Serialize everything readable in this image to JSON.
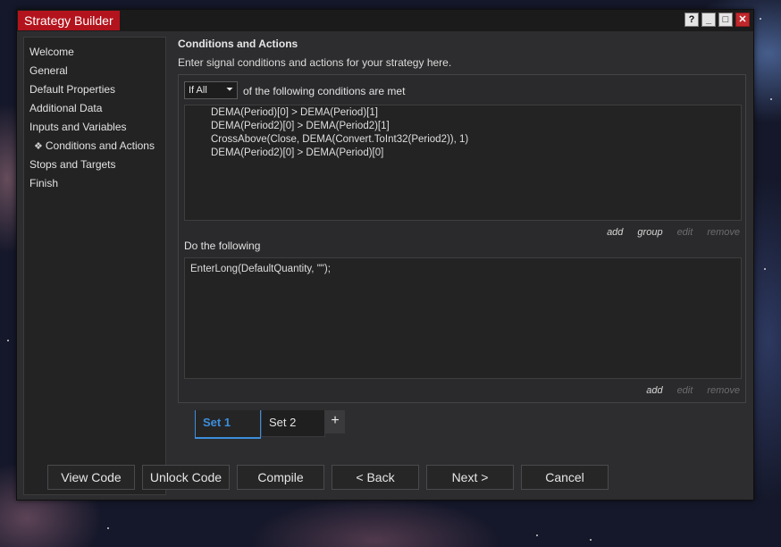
{
  "window": {
    "title": "Strategy Builder",
    "controls": {
      "help": "?",
      "minimize": "_",
      "maximize": "□",
      "close": "✕"
    }
  },
  "sidebar": {
    "items": [
      {
        "label": "Welcome"
      },
      {
        "label": "General"
      },
      {
        "label": "Default Properties"
      },
      {
        "label": "Additional Data"
      },
      {
        "label": "Inputs and Variables"
      },
      {
        "label": "Conditions and Actions",
        "bullet": "❖"
      },
      {
        "label": "Stops and Targets"
      },
      {
        "label": "Finish"
      }
    ]
  },
  "main": {
    "heading": "Conditions and Actions",
    "subheading": "Enter signal conditions and actions for your strategy here.",
    "conditions": {
      "mode_selected": "If All",
      "mode_arrow": "❯",
      "mode_suffix": "of the following conditions are met",
      "lines": [
        "DEMA(Period)[0] > DEMA(Period)[1]",
        "DEMA(Period2)[0] > DEMA(Period2)[1]",
        "CrossAbove(Close, DEMA(Convert.ToInt32(Period2)), 1)",
        "DEMA(Period2)[0] > DEMA(Period)[0]"
      ],
      "links": {
        "add": "add",
        "group": "group",
        "edit": "edit",
        "remove": "remove"
      }
    },
    "actions": {
      "label": "Do the following",
      "lines": [
        "EnterLong(DefaultQuantity, \"\");"
      ],
      "links": {
        "add": "add",
        "edit": "edit",
        "remove": "remove"
      }
    },
    "sets": {
      "tabs": [
        {
          "label": "Set 1"
        },
        {
          "label": "Set 2"
        }
      ],
      "add_label": "+"
    }
  },
  "footer": {
    "view_code": "View Code",
    "unlock_code": "Unlock Code",
    "compile": "Compile",
    "back": "< Back",
    "next": "Next >",
    "cancel": "Cancel"
  },
  "colors": {
    "title_accent": "#b3131c",
    "active_tab": "#3d8edb",
    "window_bg": "#2d2d2f"
  }
}
